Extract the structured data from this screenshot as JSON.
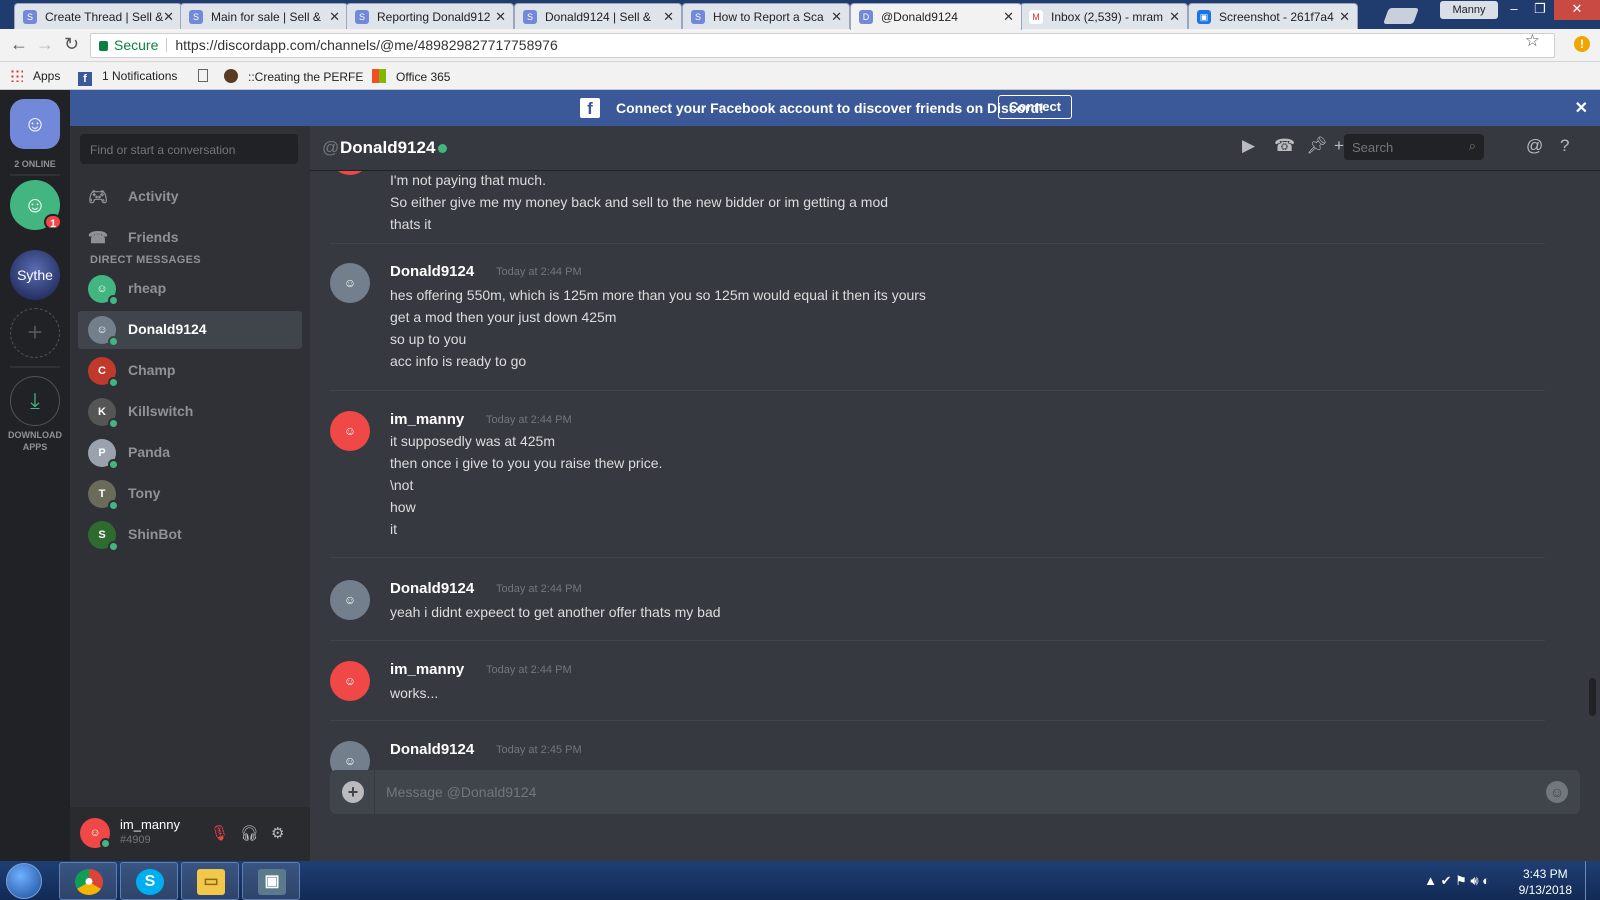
{
  "browser": {
    "tabs": [
      {
        "title": "Create Thread | Sell &",
        "icon": "forum-icon"
      },
      {
        "title": "Main for sale | Sell &",
        "icon": "forum-icon"
      },
      {
        "title": "Reporting Donald912",
        "icon": "forum-icon"
      },
      {
        "title": "Donald9124 | Sell &",
        "icon": "forum-icon"
      },
      {
        "title": "How to Report a Sca",
        "icon": "forum-icon"
      },
      {
        "title": "@Donald9124",
        "icon": "discord-icon",
        "active": true
      },
      {
        "title": "Inbox (2,539) - mram",
        "icon": "gmail-icon"
      },
      {
        "title": "Screenshot - 261f7a4",
        "icon": "screenshot-icon"
      }
    ],
    "user_chip": "Manny",
    "secure_label": "Secure",
    "url": "https://discordapp.com/channels/@me/489829827717758976",
    "bookmarks": {
      "apps": "Apps",
      "notifications": "1 Notifications",
      "creating": "::Creating the PERFE",
      "office": "Office 365"
    }
  },
  "banner": {
    "text": "Connect your Facebook account to discover friends on Discord!",
    "button": "Connect",
    "close": "✕"
  },
  "guilds": {
    "online_label": "2 ONLINE",
    "badge": "1",
    "sythe_label": "Sythe",
    "download_label_1": "DOWNLOAD",
    "download_label_2": "APPS"
  },
  "dm_panel": {
    "search_placeholder": "Find or start a conversation",
    "nav": [
      {
        "label": "Activity",
        "icon": "gamepad-icon"
      },
      {
        "label": "Friends",
        "icon": "friends-icon"
      }
    ],
    "heading": "DIRECT MESSAGES",
    "dms": [
      {
        "name": "rheap",
        "color": "#43b581"
      },
      {
        "name": "Donald9124",
        "color": "#747f8d",
        "selected": true
      },
      {
        "name": "Champ",
        "color": "#c0392b"
      },
      {
        "name": "Killswitch",
        "color": "#555555"
      },
      {
        "name": "Panda",
        "color": "#9aa3ad"
      },
      {
        "name": "Tony",
        "color": "#6b6b5a"
      },
      {
        "name": "ShinBot",
        "color": "#2e6b2e"
      }
    ],
    "user": {
      "name": "im_manny",
      "tag": "#4909"
    }
  },
  "chat": {
    "at": "@",
    "name": "Donald9124",
    "search_placeholder": "Search",
    "composer_placeholder": "Message @Donald9124",
    "groups": [
      {
        "author": "",
        "time": "",
        "avatar": "red",
        "lines": [
          "I'm not paying that much.",
          "So either give me my money back and sell to the new bidder or im getting a mod",
          "thats it"
        ]
      },
      {
        "author": "Donald9124",
        "time": "Today at 2:44 PM",
        "avatar": "grey",
        "lines": [
          "hes offering 550m, which is 125m more than you so 125m would equal it then its yours",
          "get a mod then your just down 425m",
          "so up to you",
          "acc info is ready to go"
        ]
      },
      {
        "author": "im_manny",
        "time": "Today at 2:44 PM",
        "avatar": "red",
        "lines": [
          "it supposedly was at 425m",
          "then once i give to you you raise thew price.",
          "\\not",
          "how",
          "it"
        ]
      },
      {
        "author": "Donald9124",
        "time": "Today at 2:44 PM",
        "avatar": "grey",
        "lines": [
          "yeah i didnt expeect to get another offer thats my bad"
        ]
      },
      {
        "author": "im_manny",
        "time": "Today at 2:44 PM",
        "avatar": "red",
        "lines": [
          "works..."
        ]
      },
      {
        "author": "Donald9124",
        "time": "Today at 2:45 PM",
        "avatar": "grey",
        "lines": []
      }
    ]
  },
  "taskbar": {
    "time": "3:43 PM",
    "date": "9/13/2018"
  },
  "colors": {
    "blurple": "#7289da",
    "online": "#43b581",
    "danger": "#f04747",
    "facebook": "#3b5998"
  }
}
